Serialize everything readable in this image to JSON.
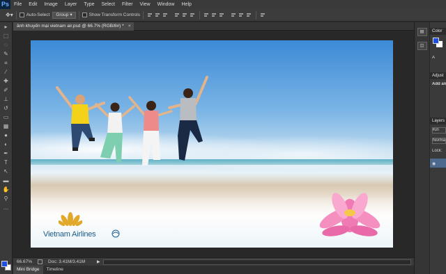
{
  "app": {
    "logo": "Ps"
  },
  "menu": [
    "File",
    "Edit",
    "Image",
    "Layer",
    "Type",
    "Select",
    "Filter",
    "View",
    "Window",
    "Help"
  ],
  "options": {
    "auto_select_label": "Auto-Select",
    "group_value": "Group",
    "show_transform_label": "Show Transform Controls"
  },
  "document": {
    "tab_title": "ảnh khuyến mại vietnam air.psd @ 66.7% (RGB/8#) *",
    "close_glyph": "×"
  },
  "image": {
    "logo_text": "Vietnam Airlines"
  },
  "status": {
    "zoom": "66.67%",
    "doc_info": "Doc: 3.41M/3.41M"
  },
  "bottom_tabs": [
    "Mini Bridge",
    "Timeline"
  ],
  "panels": {
    "color_label": "Color",
    "adjust_label": "Adjust",
    "add_label": "Add an",
    "layers_label": "Layers",
    "kind_label": "Kin",
    "normal_label": "Norma",
    "lock_label": "Lock:"
  },
  "colors": {
    "foreground": "#1f4fe0",
    "background": "#ffffff"
  }
}
